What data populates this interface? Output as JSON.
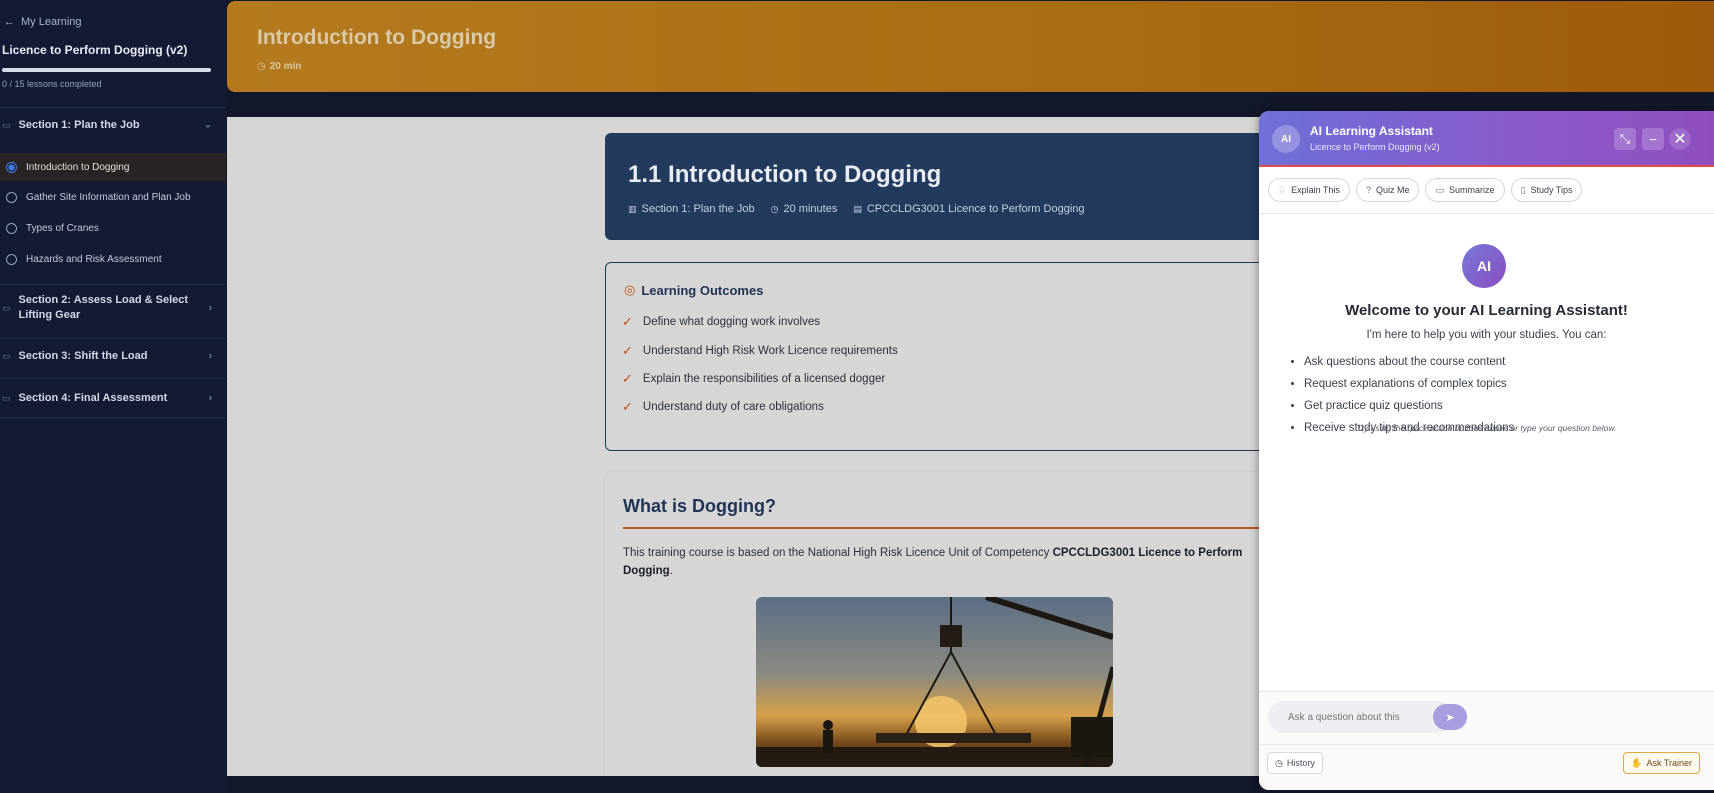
{
  "sidebar": {
    "back_label": "My Learning",
    "course_title": "Licence to Perform Dogging (v2)",
    "progress_fraction": 0.0,
    "progress_text": "0 / 15 lessons completed",
    "sections": [
      {
        "title": "Section 1: Plan the Job",
        "expanded": true
      },
      {
        "title": "Section 2: Assess Load & Select Lifting Gear",
        "expanded": false
      },
      {
        "title": "Section 3: Shift the Load",
        "expanded": false
      },
      {
        "title": "Section 4: Final Assessment",
        "expanded": false
      }
    ],
    "lessons": [
      {
        "label": "Introduction to Dogging",
        "active": true
      },
      {
        "label": "Gather Site Information and Plan Job",
        "active": false
      },
      {
        "label": "Types of Cranes",
        "active": false
      },
      {
        "label": "Hazards and Risk Assessment",
        "active": false
      }
    ]
  },
  "hero": {
    "title": "Introduction to Dogging",
    "duration": "20 min"
  },
  "lesson_header": {
    "title": "1.1 Introduction to Dogging",
    "section": "Section 1: Plan the Job",
    "duration": "20 minutes",
    "unit": "CPCCLDG3001 Licence to Perform Dogging"
  },
  "outcomes": {
    "title": "Learning Outcomes",
    "items": [
      "Define what dogging work involves",
      "Understand High Risk Work Licence requirements",
      "Explain the responsibilities of a licensed dogger",
      "Understand duty of care obligations"
    ]
  },
  "what_is": {
    "title": "What is Dogging?",
    "text_before": "This training course is based on the National High Risk Licence Unit of Competency ",
    "text_bold": "CPCCLDG3001 Licence to Perform Dogging",
    "text_after": "."
  },
  "assistant": {
    "avatar": "AI",
    "title": "AI Learning Assistant",
    "subtitle": "Licence to Perform Dogging (v2)",
    "quick_actions": [
      {
        "label": "Explain This",
        "icon": "lightbulb-icon"
      },
      {
        "label": "Quiz Me",
        "icon": "question-icon"
      },
      {
        "label": "Summarize",
        "icon": "document-icon"
      },
      {
        "label": "Study Tips",
        "icon": "bookmark-icon"
      }
    ],
    "welcome": "Welcome to your AI Learning Assistant!",
    "help": "I'm here to help you with your studies. You can:",
    "bullets": [
      "Ask questions about the course content",
      "Request explanations of complex topics",
      "Get practice quiz questions",
      "Receive study tips and recommendations"
    ],
    "hint": "Try using the quick action buttons above or type your question below.",
    "input_placeholder": "Ask a question about this content...",
    "history_label": "History",
    "ask_trainer_label": "Ask Trainer"
  },
  "colors": {
    "sidebar_bg": "#141a33",
    "hero_orange": "#b57a1e",
    "header_navy": "#223a5c",
    "accent_orange": "#c25016",
    "assistant_purple": "#7a63d2"
  }
}
